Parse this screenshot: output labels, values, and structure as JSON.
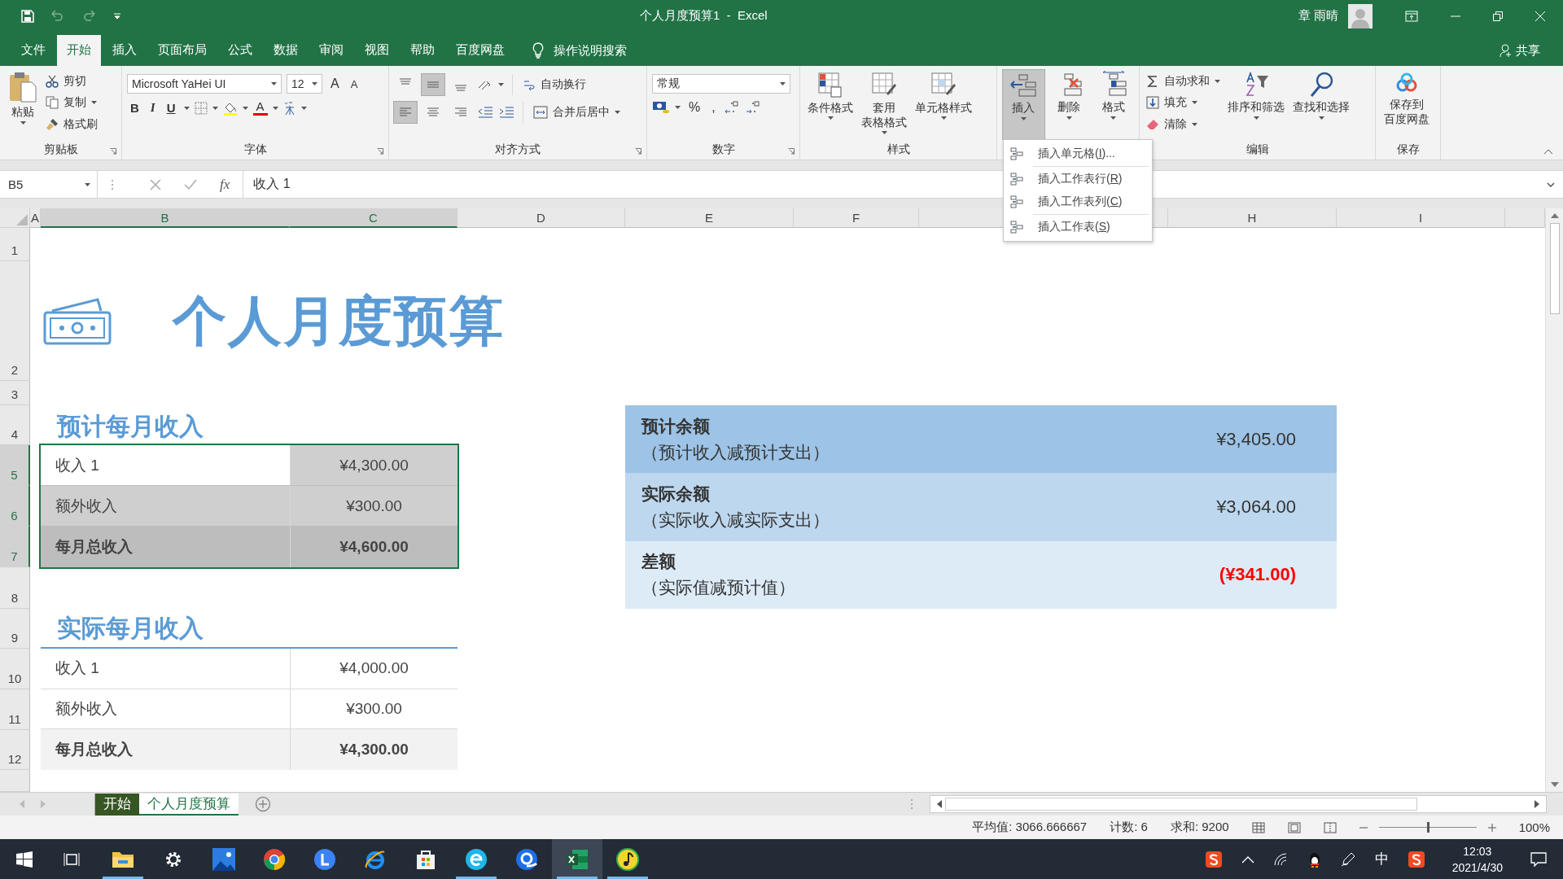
{
  "window": {
    "title": "个人月度预算1  -  Excel",
    "user": "章 雨晴"
  },
  "menu_tabs": [
    {
      "label": "文件",
      "selected": false
    },
    {
      "label": "开始",
      "selected": true
    },
    {
      "label": "插入",
      "selected": false
    },
    {
      "label": "页面布局",
      "selected": false
    },
    {
      "label": "公式",
      "selected": false
    },
    {
      "label": "数据",
      "selected": false
    },
    {
      "label": "审阅",
      "selected": false
    },
    {
      "label": "视图",
      "selected": false
    },
    {
      "label": "帮助",
      "selected": false
    },
    {
      "label": "百度网盘",
      "selected": false
    }
  ],
  "tell_me": "操作说明搜索",
  "share": "共享",
  "ribbon": {
    "clipboard": {
      "label": "剪贴板",
      "paste": "粘贴",
      "items": [
        "剪切",
        "复制",
        "格式刷"
      ]
    },
    "font": {
      "label": "字体",
      "font_name": "Microsoft YaHei UI",
      "font_size": "12",
      "size_buttons": [
        "A",
        "A"
      ],
      "style_buttons": [
        "B",
        "I",
        "U"
      ],
      "font_color": "A"
    },
    "alignment": {
      "label": "对齐方式",
      "wrap": "自动换行",
      "merge": "合并后居中",
      "vertical": [
        {
          "selected": false
        },
        {
          "selected": true
        },
        {
          "selected": false
        }
      ],
      "horizontal": [
        {
          "selected": true
        },
        {
          "selected": false
        },
        {
          "selected": false
        }
      ]
    },
    "number": {
      "label": "数字",
      "format": "常规",
      "symbols": [
        "%",
        ","
      ]
    },
    "styles": {
      "label": "样式",
      "buttons": [
        [
          "条件格式"
        ],
        [
          "套用",
          "表格格式"
        ],
        [
          "单元格样式"
        ]
      ]
    },
    "cells": {
      "buttons": [
        {
          "label": "插入",
          "selected": true
        },
        {
          "label": "删除",
          "selected": false
        },
        {
          "label": "格式",
          "selected": false
        }
      ]
    },
    "editing": {
      "label": "编辑",
      "items": [
        "自动求和",
        "填充",
        "清除"
      ],
      "buttons": [
        "排序和筛选",
        "查找和选择"
      ]
    },
    "save": {
      "label": "保存",
      "button": [
        "保存到",
        "百度网盘"
      ]
    }
  },
  "insert_menu": [
    {
      "before": "插入单元格(",
      "key": "I",
      "after": ")..."
    },
    {
      "before": "插入工作表行(",
      "key": "R",
      "after": ")"
    },
    {
      "before": "插入工作表列(",
      "key": "C",
      "after": ")"
    },
    {
      "before": "插入工作表(",
      "key": "S",
      "after": ")"
    }
  ],
  "formula_bar": {
    "name_box": "B5",
    "fx": "fx",
    "formula": "收入 1"
  },
  "columns": [
    {
      "label": "A",
      "selected": false
    },
    {
      "label": "B",
      "selected": true
    },
    {
      "label": "C",
      "selected": true
    },
    {
      "label": "D",
      "selected": false
    },
    {
      "label": "E",
      "selected": false
    },
    {
      "label": "F",
      "selected": false
    },
    {
      "selected": false
    },
    {
      "label": "H",
      "selected": false
    },
    {
      "label": "I",
      "selected": false
    }
  ],
  "rows": [
    {
      "label": "1",
      "selected": false
    },
    {
      "label": "2",
      "selected": false
    },
    {
      "label": "3",
      "selected": false
    },
    {
      "label": "4",
      "selected": false
    },
    {
      "label": "5",
      "selected": true
    },
    {
      "label": "6",
      "selected": true
    },
    {
      "label": "7",
      "selected": true
    },
    {
      "label": "8",
      "selected": false
    },
    {
      "label": "9",
      "selected": false
    },
    {
      "label": "10",
      "selected": false
    },
    {
      "label": "11",
      "selected": false
    },
    {
      "label": "12",
      "selected": false
    }
  ],
  "sheet": {
    "title": "个人月度预算",
    "estimated_income": {
      "heading": "预计每月收入",
      "selected": true,
      "rows": [
        {
          "kind": "item",
          "label": "收入 1",
          "value": "¥4,300.00"
        },
        {
          "kind": "item",
          "label": "额外收入",
          "value": "¥300.00"
        },
        {
          "kind": "total",
          "label": "每月总收入",
          "value": "¥4,600.00"
        }
      ]
    },
    "actual_income": {
      "heading": "实际每月收入",
      "selected": false,
      "rows": [
        {
          "kind": "item",
          "label": "收入 1",
          "value": "¥4,000.00"
        },
        {
          "kind": "item",
          "label": "额外收入",
          "value": "¥300.00"
        },
        {
          "kind": "total",
          "label": "每月总收入",
          "value": "¥4,300.00"
        }
      ]
    },
    "summary": [
      {
        "title": "预计余额",
        "note": "（预计收入减预计支出）",
        "value": "¥3,405.00",
        "negative": false,
        "color": "#9dc3e6"
      },
      {
        "title": "实际余额",
        "note": "（实际收入减实际支出）",
        "value": "¥3,064.00",
        "negative": false,
        "color": "#bdd7ee"
      },
      {
        "title": "差额",
        "note": "（实际值减预计值）",
        "value": "(¥341.00)",
        "negative": true,
        "color": "#ddebf7"
      }
    ]
  },
  "sheet_tabs": [
    {
      "label": "开始",
      "selected": false,
      "color": "#375623"
    },
    {
      "label": "个人月度预算",
      "selected": true
    }
  ],
  "status_bar": {
    "stats": [
      "平均值: 3066.666667",
      "计数: 6",
      "求和: 9200"
    ],
    "zoom_slider": {
      "level": 0.5
    },
    "zoom": "100%"
  },
  "taskbar": {
    "apps": [
      {
        "kind": "task-view",
        "running": false,
        "active": false
      },
      {
        "kind": "folder",
        "running": true,
        "active": false
      },
      {
        "kind": "gear",
        "running": false,
        "active": false
      },
      {
        "kind": "photo",
        "running": false,
        "active": false
      },
      {
        "kind": "chrome",
        "running": false,
        "active": false
      },
      {
        "kind": "l-circle",
        "running": false,
        "active": false
      },
      {
        "kind": "ie",
        "running": false,
        "active": false
      },
      {
        "kind": "store",
        "running": false,
        "active": false
      },
      {
        "kind": "e-circle",
        "running": true,
        "active": false
      },
      {
        "kind": "q-circle",
        "running": false,
        "active": false
      },
      {
        "kind": "excel",
        "running": true,
        "active": true
      },
      {
        "kind": "music",
        "running": true,
        "active": false
      }
    ],
    "ime": "中",
    "time": "12:03",
    "date": "2021/4/30"
  }
}
